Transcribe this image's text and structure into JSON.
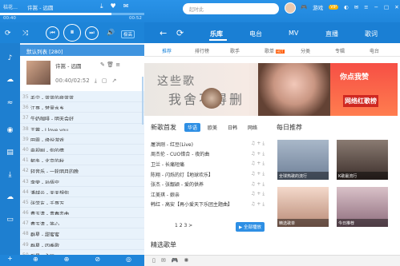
{
  "topbar": {
    "brand_text": "桔花…",
    "song_title": "许嵩 - 远圆",
    "time_current": "00:40",
    "time_total": "00:52",
    "progress": 0.77,
    "search_placeholder": "起时此",
    "user_name": "游戏",
    "vip": "VIP"
  },
  "controls": {
    "quality": "极高"
  },
  "nav": {
    "tabs": [
      "乐库",
      "电台",
      "MV",
      "直播",
      "歌词"
    ],
    "active": "乐库"
  },
  "playlist": {
    "header": "默认列表 [280]",
    "current": {
      "title": "许嵩 - 远圆",
      "time": "00:40/02:52"
    },
    "items": [
      {
        "n": "35",
        "title": "毛宁 - 蓝蓝的夜蓝蓝"
      },
      {
        "n": "36",
        "title": "江哥 - 梦里水乡"
      },
      {
        "n": "37",
        "title": "牛奶咖啡 - 明天会好"
      },
      {
        "n": "38",
        "title": "王蓉 - I love you"
      },
      {
        "n": "39",
        "title": "田震 - 缘份游戏"
      },
      {
        "n": "40",
        "title": "电视剧 - 你的情"
      },
      {
        "n": "41",
        "title": "郁冬 - 北京的秋"
      },
      {
        "n": "42",
        "title": "轻音乐 - 一轮明月的晚"
      },
      {
        "n": "43",
        "title": "李荣 - 孙悟空"
      },
      {
        "n": "44",
        "title": "潘越云 - 天天想你"
      },
      {
        "n": "45",
        "title": "张学友 - 千哥万"
      },
      {
        "n": "46",
        "title": "费玉清 - 青春恋曲"
      },
      {
        "n": "47",
        "title": "费玉清 - 答心"
      },
      {
        "n": "48",
        "title": "群星 - 甜蜜蜜"
      },
      {
        "n": "49",
        "title": "群星 - 四季歌"
      },
      {
        "n": "50",
        "title": "群星 - 永远"
      }
    ]
  },
  "content": {
    "subtabs": [
      "推荐",
      "排行榜",
      "歌手",
      "歌单",
      "分类",
      "专辑",
      "电台"
    ],
    "hot_badge": "HOT",
    "banner_title": "这些歌",
    "banner_sub": "我舍不得删",
    "banner_right_1": "你点我赞",
    "banner_right_2": "网络红歌榜",
    "new_songs_title": "新歌首发",
    "new_tabs": [
      "华语",
      "欧美",
      "日韩",
      "网络"
    ],
    "new_songs": [
      "屠洪刚 - 红豆(Live)",
      "周杰伦 - CUO错合 - 夜的曲",
      "卫兰 - 长痛短痛",
      "陈翔 - 闪烁的灯【地球欢乐】",
      "张杰 - 张靓颖 - 爱的供养",
      "江美琪 - 娘亲",
      "韩红 - 高安【再小爱天下乐团主题曲】"
    ],
    "pager": "1 2 3 >",
    "play_all": "▶ 全部播放",
    "daily_title": "每日推荐",
    "tiles": [
      {
        "caption": "全球热歌的流行"
      },
      {
        "caption": "K歌最流行"
      },
      {
        "caption": "精选歌单"
      },
      {
        "caption": "今日推荐"
      }
    ],
    "featured_title": "精选歌单"
  },
  "colors": {
    "brand": "#1f86db",
    "bg": "#e8f2fb",
    "hot": "#ff5a00"
  }
}
